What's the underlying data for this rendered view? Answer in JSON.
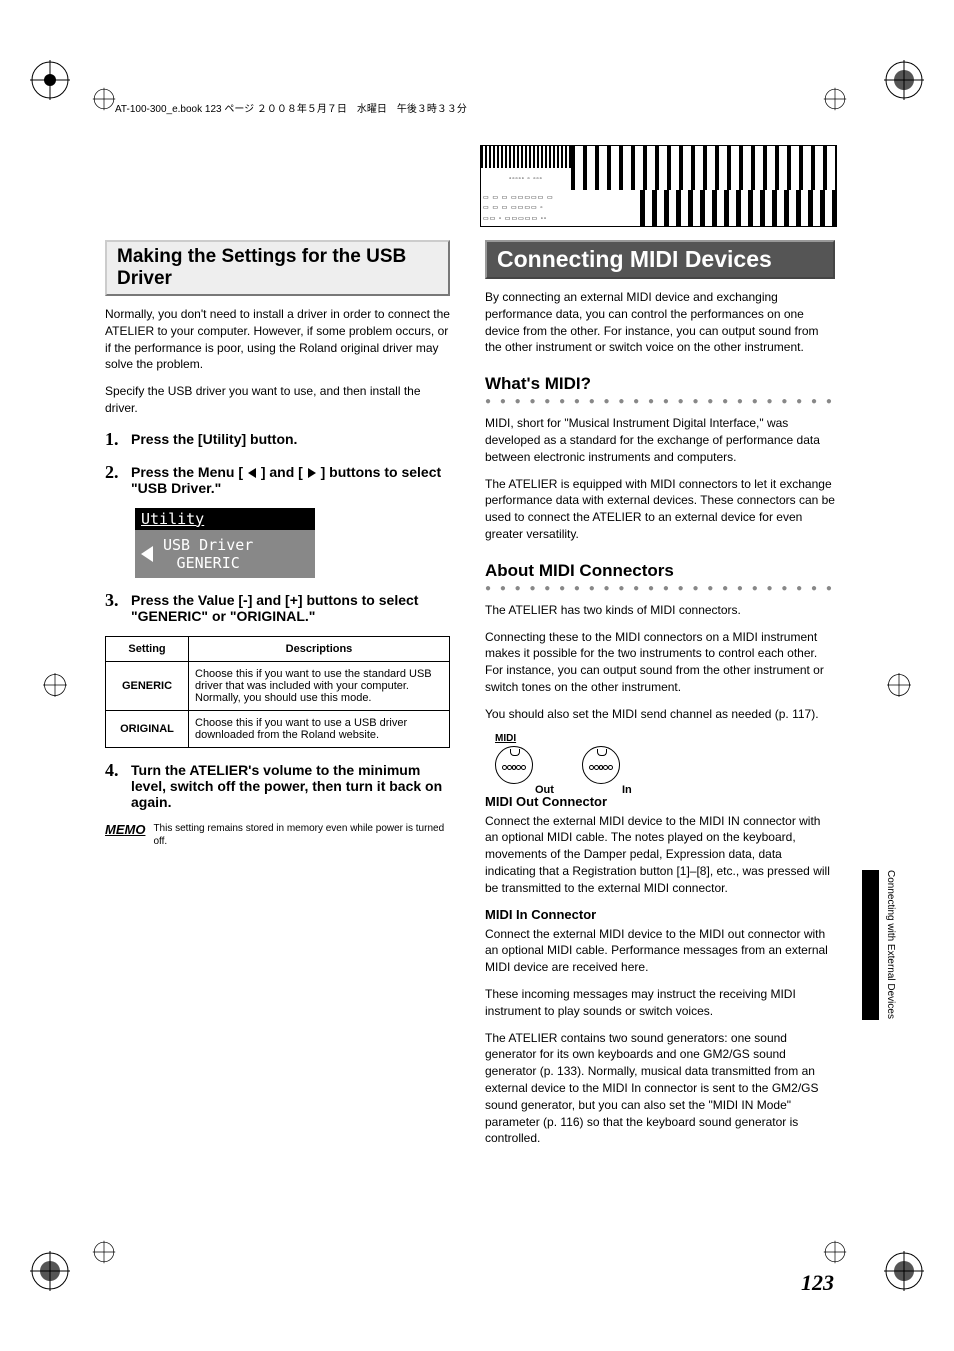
{
  "footline": "AT-100-300_e.book  123 ページ  ２００８年５月７日　水曜日　午後３時３３分",
  "left": {
    "title": "Making the Settings for the USB Driver",
    "intro1": "Normally, you don't need to install a driver in order to connect the ATELIER to your computer. However, if some problem occurs, or if the performance is poor, using the Roland original driver may solve the problem.",
    "intro2": "Specify the USB driver you want to use, and then install the driver.",
    "step1": "Press the [Utility] button.",
    "step2a": "Press the Menu [",
    "step2b": "] and [",
    "step2c": "] buttons to select \"USB Driver.\"",
    "lcd_title": "Utility",
    "lcd_l1": "USB Driver",
    "lcd_l2": "GENERIC",
    "step3": "Press the Value [-] and [+] buttons to select \"GENERIC\" or \"ORIGINAL.\"",
    "th1": "Setting",
    "th2": "Descriptions",
    "r1c1": "GENERIC",
    "r1c2": "Choose this if you want to use the standard USB driver that was included with your computer.\nNormally, you should use this mode.",
    "r2c1": "ORIGINAL",
    "r2c2": "Choose this if you want to use a USB driver downloaded from the Roland website.",
    "step4": "Turn the ATELIER's volume to the minimum level, switch off the power, then turn it back on again.",
    "memo_lbl": "MEMO",
    "memo": "This setting remains stored in memory even while power is turned off."
  },
  "right": {
    "title": "Connecting MIDI Devices",
    "intro": "By connecting an external MIDI device and exchanging performance data, you can control the performances on one device from the other. For instance, you can output sound from the other instrument or switch voice on the other instrument.",
    "h2a": "What's MIDI?",
    "p2a": "MIDI, short for \"Musical Instrument Digital Interface,\" was developed as a standard for the exchange of performance data between electronic instruments and computers.",
    "p2b": "The ATELIER is equipped with MIDI connectors to let it exchange performance data with external devices. These connectors can be used to connect the ATELIER to an external device for even greater versatility.",
    "h2b": "About MIDI Connectors",
    "p3a": "The ATELIER has two kinds of MIDI connectors.",
    "p3b": "Connecting these to the MIDI connectors on a MIDI instrument makes it possible for the two instruments to control each other. For instance, you can output sound from the other instrument or switch tones on the other instrument.",
    "p3c": "You should also set the MIDI send channel as needed (p. 117).",
    "jack_grp": "MIDI",
    "jack_out": "Out",
    "jack_in": "In",
    "h3a": "MIDI Out Connector",
    "p4": "Connect the external MIDI device to the MIDI IN connector with an optional MIDI cable. The notes played on the keyboard, movements of the Damper pedal, Expression data, data indicating that a Registration button [1]–[8], etc., was pressed will be transmitted to the external MIDI connector.",
    "h3b": "MIDI In Connector",
    "p5a": "Connect the external MIDI device to the MIDI out connector with an optional MIDI cable. Performance messages from an external MIDI device are received here.",
    "p5b": "These incoming messages may instruct the receiving MIDI instrument to play sounds or switch voices.",
    "p5c": "The ATELIER contains two sound generators: one sound generator for its own keyboards and one GM2/GS sound generator (p. 133). Normally, musical data transmitted from an external device to the MIDI In connector is sent to the GM2/GS sound generator, but you can also set the \"MIDI IN Mode\" parameter (p. 116) so that the keyboard sound generator is controlled."
  },
  "side": "Connecting with External Devices",
  "pagenum": "123"
}
